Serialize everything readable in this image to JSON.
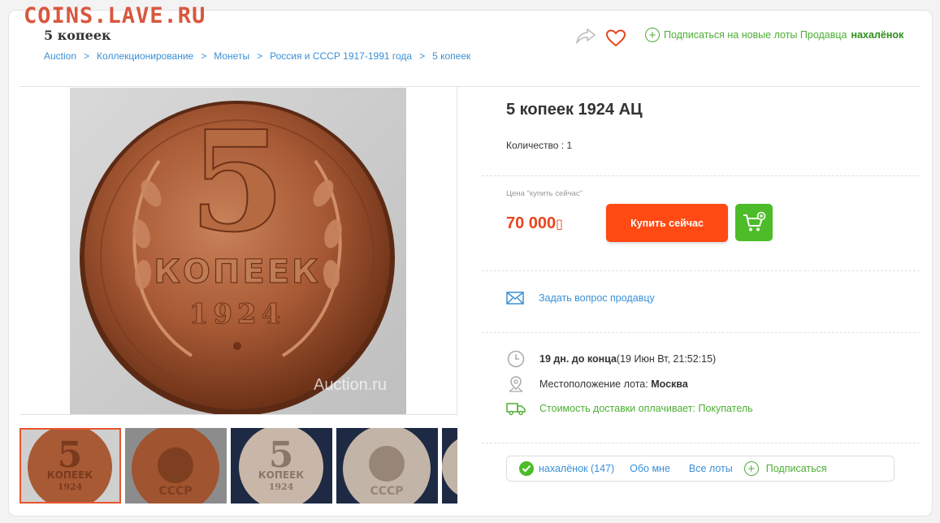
{
  "watermark": "COINS.LAVE.RU",
  "header": {
    "title": "5 копеек",
    "breadcrumb": [
      "Auction",
      "Коллекционирование",
      "Монеты",
      "Россия и СССР 1917-1991 года",
      "5 копеек"
    ],
    "subscribe_prefix": "Подписаться на новые лоты Продавца",
    "seller_name": "нахалёнок",
    "icons": [
      "share-icon",
      "heart-icon",
      "plus-circle-icon"
    ]
  },
  "gallery": {
    "main_overlay": "Auction.ru",
    "coin_denomination": "5",
    "coin_word": "КОПЕЕК",
    "coin_year": "1924",
    "thumbnails": [
      {
        "kind": "reverse-copper",
        "active": true
      },
      {
        "kind": "obverse-copper",
        "active": false
      },
      {
        "kind": "reverse-light",
        "active": false
      },
      {
        "kind": "obverse-light",
        "active": false
      },
      {
        "kind": "partial",
        "active": false
      }
    ]
  },
  "lot": {
    "title": "5 копеек 1924 АЦ",
    "quantity_label": "Количество : 1",
    "price_caption": "Цена \"купить сейчас\"",
    "price": "70 000",
    "currency_glyph": "▯",
    "buy_label": "Купить сейчас",
    "ask_label": "Задать вопрос продавцу",
    "end_bold": "19 дн. до конца",
    "end_detail": " (19 Июн Вт, 21:52:15)",
    "location_label": "Местоположение лота: ",
    "location_value": "Москва",
    "shipping_label": "Стоимость доставки оплачивает: Покупатель"
  },
  "seller": {
    "name_rating": "нахалёнок (147)",
    "about": "Обо мне",
    "all_lots": "Все лоты",
    "subscribe": "Подписаться"
  },
  "colors": {
    "accent_red": "#ff4a13",
    "price_red": "#e8451e",
    "green": "#4cbc28",
    "link_blue": "#3a8fd6",
    "watermark": "#d9573e"
  }
}
